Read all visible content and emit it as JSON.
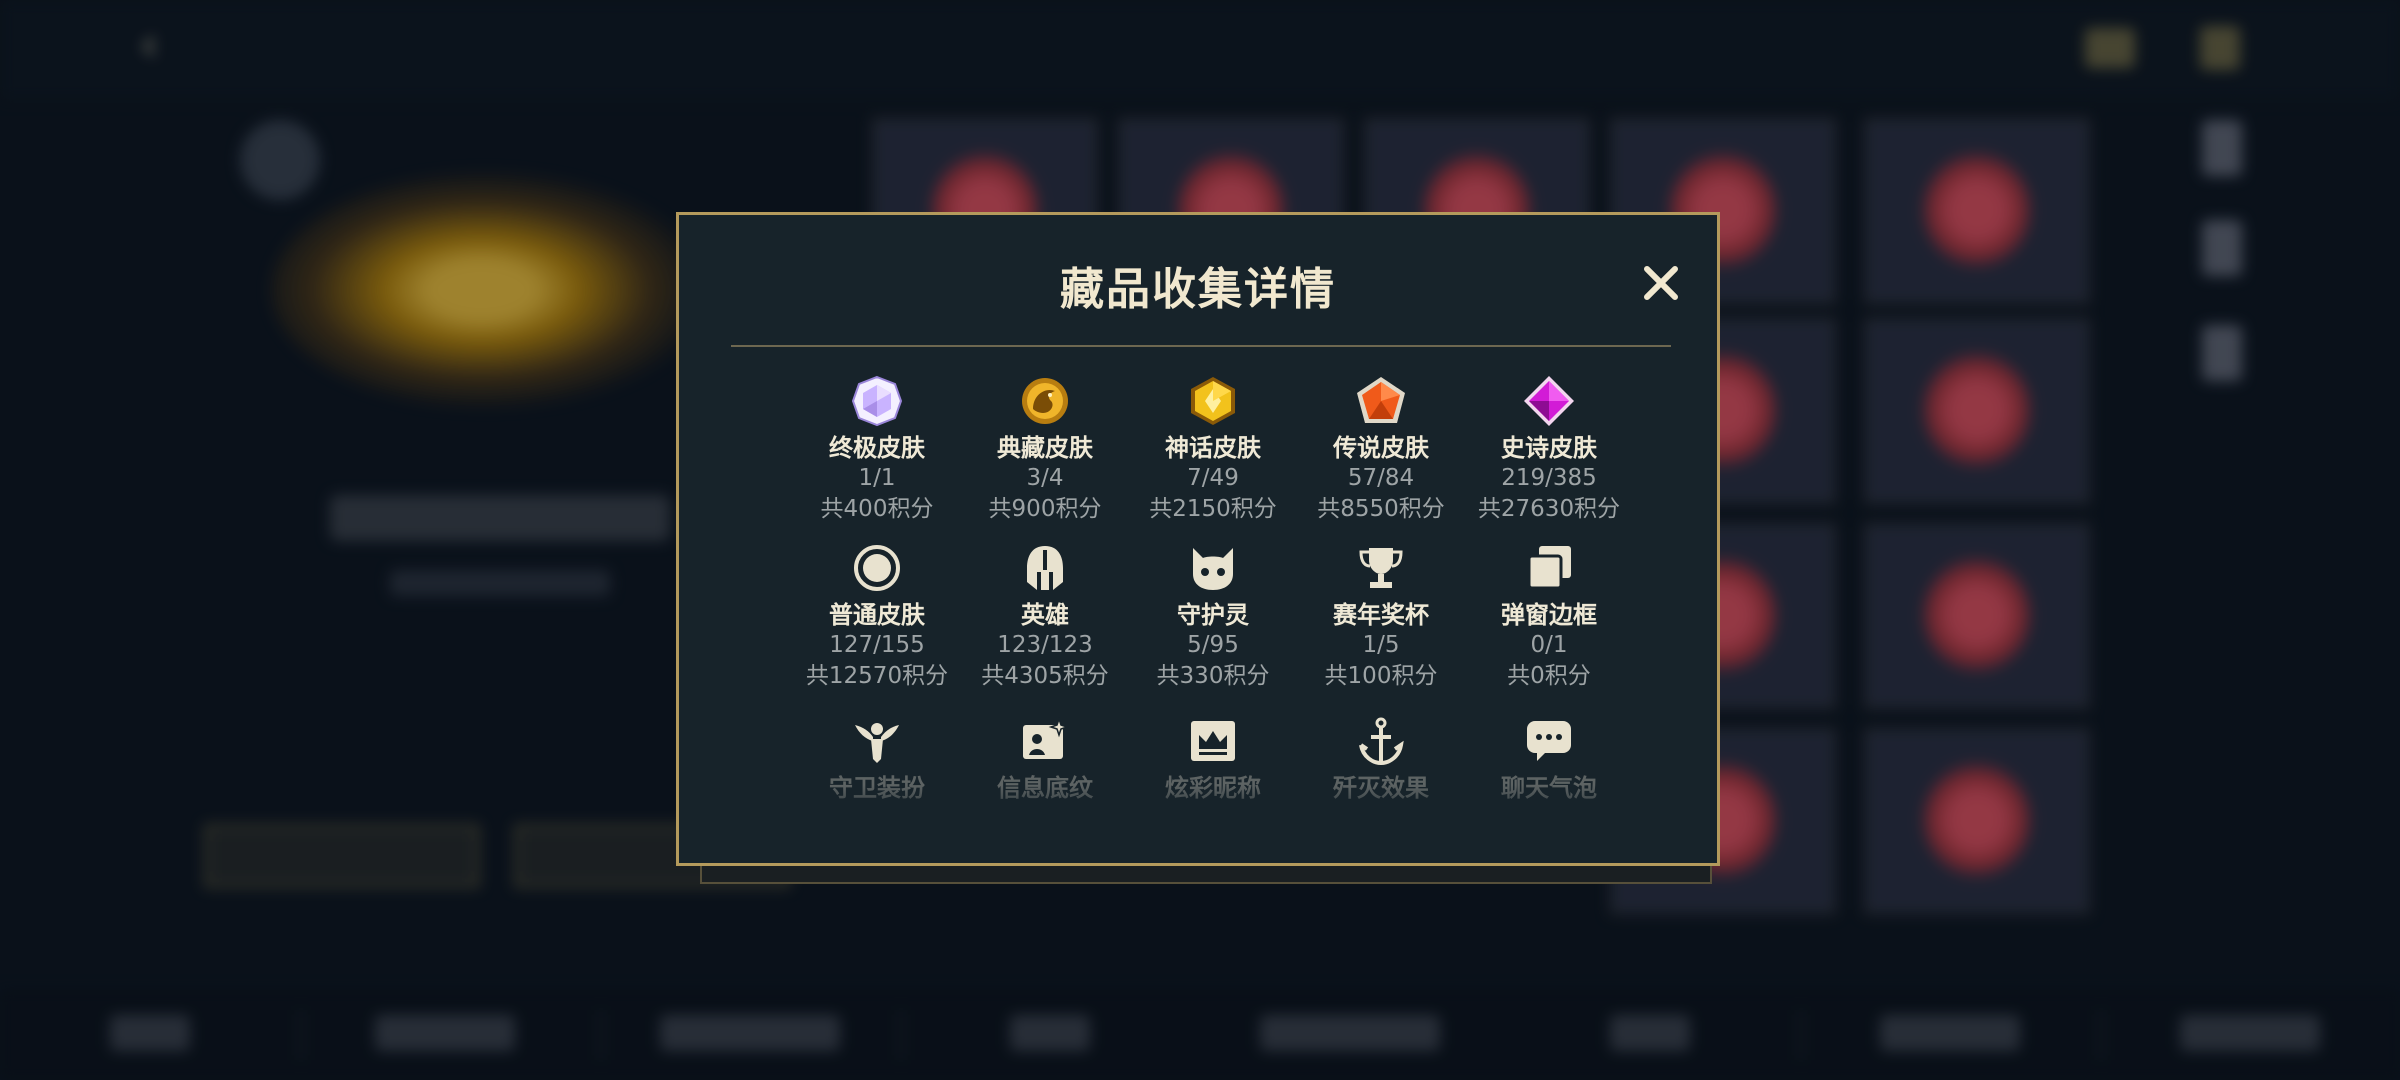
{
  "modal": {
    "title": "藏品收集详情",
    "close_label": "×"
  },
  "categories": [
    {
      "name": "终极皮肤",
      "count": "1/1",
      "points": "共400积分",
      "icon": "ultimate-skin-gem-icon",
      "color": "#c9b3ff"
    },
    {
      "name": "典藏皮肤",
      "count": "3/4",
      "points": "共900积分",
      "icon": "collector-skin-dragon-icon",
      "color": "#e0a51a"
    },
    {
      "name": "神话皮肤",
      "count": "7/49",
      "points": "共2150积分",
      "icon": "mythic-skin-gem-icon",
      "color": "#f2c21c"
    },
    {
      "name": "传说皮肤",
      "count": "57/84",
      "points": "共8550积分",
      "icon": "legendary-skin-gem-icon",
      "color": "#f05a1a"
    },
    {
      "name": "史诗皮肤",
      "count": "219/385",
      "points": "共27630积分",
      "icon": "epic-skin-gem-icon",
      "color": "#d21bd6"
    },
    {
      "name": "普通皮肤",
      "count": "127/155",
      "points": "共12570积分",
      "icon": "normal-skin-ring-icon",
      "color": "#e8e2cf"
    },
    {
      "name": "英雄",
      "count": "123/123",
      "points": "共4305积分",
      "icon": "hero-helmet-icon",
      "color": "#e8e2cf"
    },
    {
      "name": "守护灵",
      "count": "5/95",
      "points": "共330积分",
      "icon": "guardian-spirit-icon",
      "color": "#e8e2cf"
    },
    {
      "name": "赛年奖杯",
      "count": "1/5",
      "points": "共100积分",
      "icon": "season-trophy-icon",
      "color": "#e8e2cf"
    },
    {
      "name": "弹窗边框",
      "count": "0/1",
      "points": "共0积分",
      "icon": "popup-frame-icon",
      "color": "#e8e2cf"
    },
    {
      "name": "守卫装扮",
      "icon": "guard-outfit-icon",
      "color": "#e8e2cf"
    },
    {
      "name": "信息底纹",
      "icon": "info-background-icon",
      "color": "#e8e2cf"
    },
    {
      "name": "炫彩昵称",
      "icon": "colorful-nickname-icon",
      "color": "#e8e2cf"
    },
    {
      "name": "歼灭效果",
      "icon": "annihilation-effect-icon",
      "color": "#e8e2cf"
    },
    {
      "name": "聊天气泡",
      "icon": "chat-bubble-icon",
      "color": "#e8e2cf"
    }
  ],
  "colors": {
    "accent_gold": "#b49a5c",
    "modal_bg": "#17232a",
    "title_text": "#f1e8cf",
    "secondary_text": "#9ea4a6"
  }
}
